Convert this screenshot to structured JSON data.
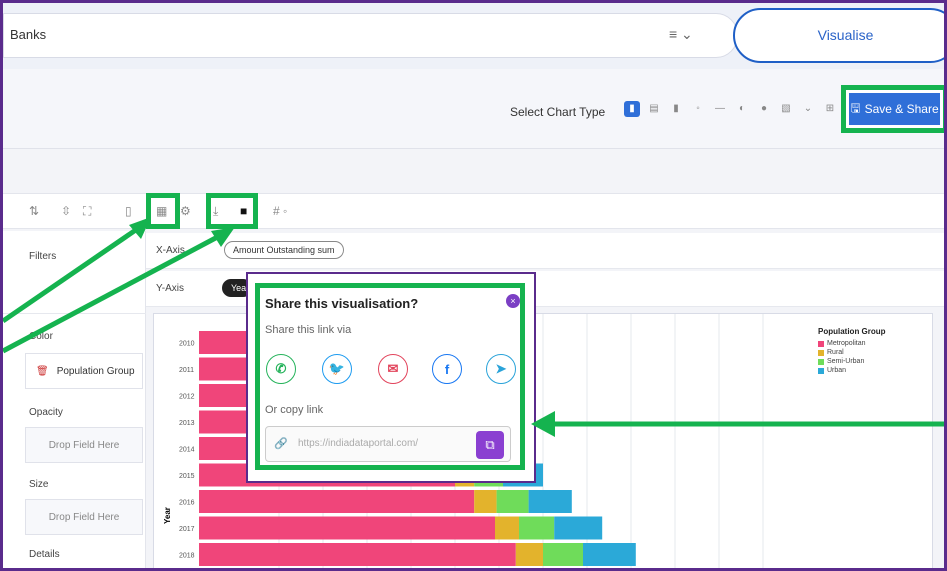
{
  "search": {
    "text": "Banks"
  },
  "header": {
    "visualise_label": "Visualise"
  },
  "chart_type": {
    "label": "Select Chart Type",
    "icons": [
      "bar-chart-icon",
      "stacked-bar-icon",
      "column-icon",
      "dot-icon",
      "line-icon",
      "pie-icon",
      "scatter-icon",
      "area-icon",
      "chevron-down-icon",
      "table-icon"
    ]
  },
  "save_share": {
    "label": "Save & Share"
  },
  "left_panel": {
    "filters": "Filters",
    "color": "Color",
    "color_field": "Population Group",
    "opacity": "Opacity",
    "drop1": "Drop Field Here",
    "size": "Size",
    "drop2": "Drop Field Here",
    "details": "Details"
  },
  "axes": {
    "x_label": "X-Axis",
    "x_field": "Amount Outstanding  sum",
    "y_label": "Y-Axis",
    "y_field": "Year"
  },
  "share_popup": {
    "title": "Share this visualisation?",
    "via": "Share this link via",
    "copy": "Or copy link",
    "url": "https://indiadataportal.com/",
    "close": "×"
  },
  "chart_data": {
    "type": "bar",
    "orientation": "horizontal",
    "stacked": true,
    "categories": [
      "2010",
      "2011",
      "2012",
      "2013",
      "2014",
      "2015",
      "2016",
      "2017",
      "2018"
    ],
    "ylabel": "Year",
    "legend_title": "Population Group",
    "legend_position": "top-right",
    "series": [
      {
        "name": "Metropolitan",
        "color": "#f0457a",
        "values": [
          100,
          105,
          110,
          118,
          125,
          160,
          172,
          185,
          198
        ]
      },
      {
        "name": "Rural",
        "color": "#e3b32c",
        "values": [
          0,
          0,
          0,
          0,
          0,
          12,
          14,
          15,
          17
        ]
      },
      {
        "name": "Semi-Urban",
        "color": "#6fdc5a",
        "values": [
          0,
          0,
          0,
          0,
          0,
          18,
          20,
          22,
          25
        ]
      },
      {
        "name": "Urban",
        "color": "#2ba9d8",
        "values": [
          0,
          0,
          0,
          0,
          0,
          25,
          27,
          30,
          33
        ]
      }
    ],
    "visible_years_chart": [
      "2010",
      "2011",
      "2012",
      "2013",
      "2014",
      "2015",
      "2016",
      "2017",
      "2018"
    ]
  }
}
